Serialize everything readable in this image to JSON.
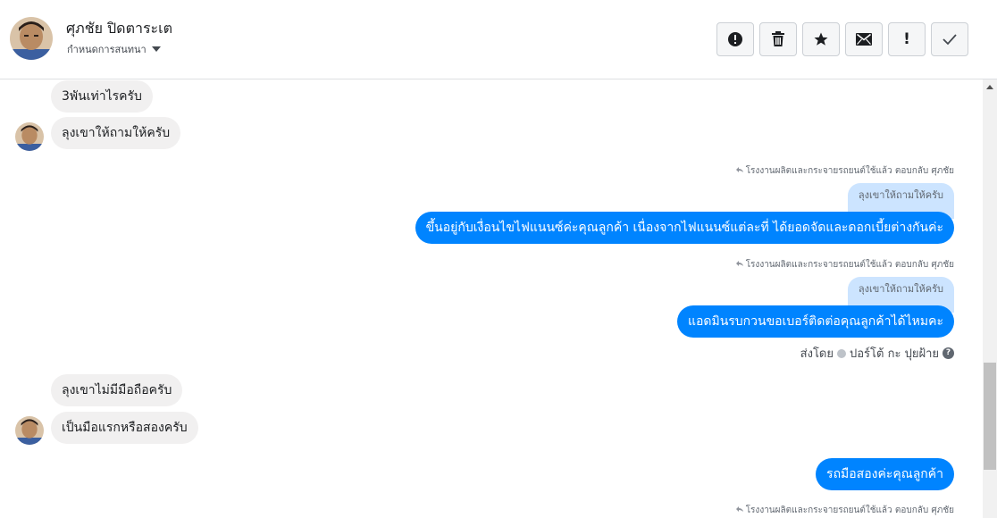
{
  "header": {
    "name": "ศุภชัย ปิดตาระเต",
    "subtitle": "กำหนดการสนทนา",
    "avatar_icon": "profile-photo"
  },
  "toolbar": {
    "buttons": [
      {
        "icon": "report-icon"
      },
      {
        "icon": "trash-icon"
      },
      {
        "icon": "star-icon"
      },
      {
        "icon": "mail-icon"
      },
      {
        "icon": "exclamation-icon",
        "label": "!"
      },
      {
        "icon": "check-icon"
      }
    ]
  },
  "messages": {
    "m1": "3พันเท่าไรครับ",
    "m2": "ลุงเขาให้ถามให้ครับ",
    "r1_meta": "โรงงานผลิตและกระจายรถยนต์ใช้แล้ว ตอบกลับ ศุภชัย",
    "r1_quote": "ลุงเขาให้ถามให้ครับ",
    "r1_text": "ขึ้นอยู่กับเงื่อนไขไฟแนนซ์ค่ะคุณลูกค้า เนื่องจากไฟแนนซ์แต่ละที่ ได้ยอดจัดและดอกเบี้ยต่างกันค่ะ",
    "r2_meta": "โรงงานผลิตและกระจายรถยนต์ใช้แล้ว ตอบกลับ ศุภชัย",
    "r2_quote": "ลุงเขาให้ถามให้ครับ",
    "r2_text": "แอดมินรบกวนขอเบอร์ติดต่อคุณลูกค้าได้ไหมคะ",
    "sent_by_prefix": "ส่งโดย",
    "sent_by_name": "ปอร์โต้ กะ ปุยฝ้าย",
    "m3": "ลุงเขาไม่มีมือถือครับ",
    "m4": "เป็นมือแรกหรือสองครับ",
    "r3_text": "รถมือสองค่ะคุณลูกค้า",
    "r4_meta": "โรงงานผลิตและกระจายรถยนต์ใช้แล้ว ตอบกลับ ศุภชัย"
  },
  "colors": {
    "outgoing": "#0084ff",
    "incoming": "#f1f0f0",
    "quote": "#cce4ff"
  }
}
